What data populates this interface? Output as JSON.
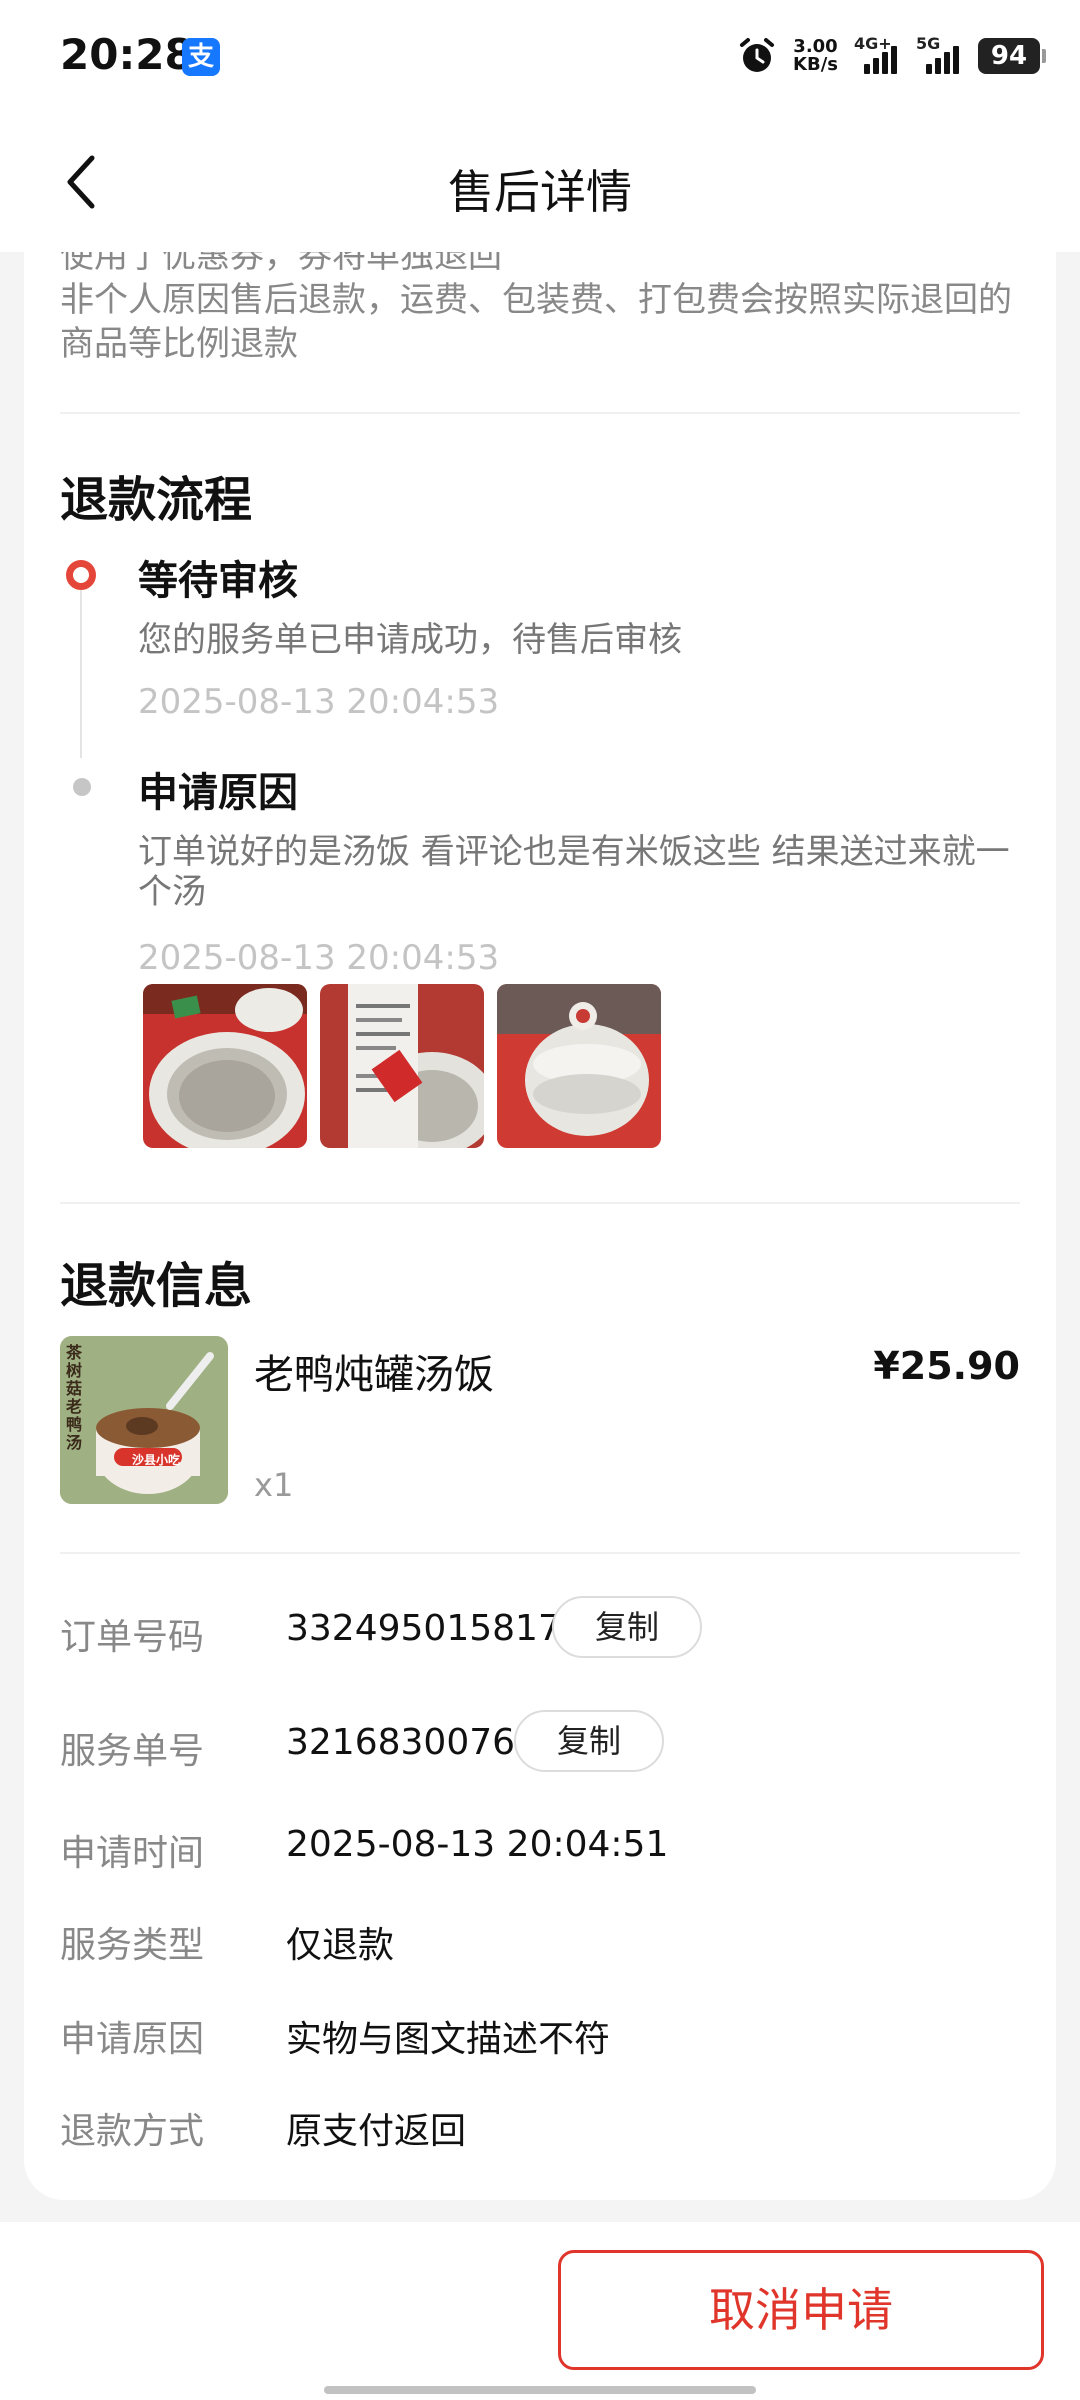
{
  "status_bar": {
    "time": "20:28",
    "app_badge": "支",
    "network_speed_value": "3.00",
    "network_speed_unit": "KB/s",
    "sim1_label": "4G+",
    "sim2_label": "5G",
    "battery": "94"
  },
  "nav": {
    "title": "售后详情"
  },
  "notes": {
    "cut_line": "使用了优惠券，券将单独退回",
    "refund_rule": "非个人原因售后退款，运费、包装费、打包费会按照实际退回的商品等比例退款"
  },
  "refund_process": {
    "title": "退款流程",
    "steps": [
      {
        "title": "等待审核",
        "desc": "您的服务单已申请成功，待售后审核",
        "time": "2025-08-13 20:04:53"
      },
      {
        "title": "申请原因",
        "desc": "订单说好的是汤饭  看评论也是有米饭这些  结果送过来就一个汤",
        "time": "2025-08-13 20:04:53"
      }
    ]
  },
  "refund_info": {
    "title": "退款信息",
    "product": {
      "name": "老鸭炖罐汤饭",
      "price": "¥25.90",
      "qty": "x1",
      "thumb_text": "茶树菇老鸭汤",
      "thumb_brand": "沙县小吃"
    },
    "rows": [
      {
        "label": "订单号码",
        "value": "332495015817",
        "action": "复制"
      },
      {
        "label": "服务单号",
        "value": "3216830076",
        "action": "复制"
      },
      {
        "label": "申请时间",
        "value": "2025-08-13 20:04:51"
      },
      {
        "label": "服务类型",
        "value": "仅退款"
      },
      {
        "label": "申请原因",
        "value": "实物与图文描述不符"
      },
      {
        "label": "退款方式",
        "value": "原支付返回"
      }
    ]
  },
  "bottom": {
    "cancel_label": "取消申请"
  },
  "colors": {
    "accent_red": "#e0352b",
    "timeline_active": "#e5463a",
    "alipay_blue": "#1677ff"
  }
}
